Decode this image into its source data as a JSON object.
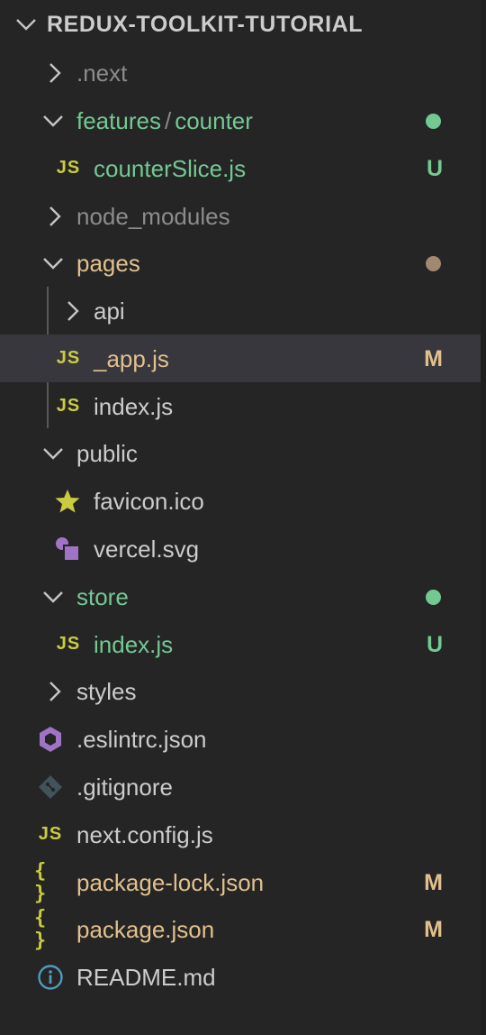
{
  "explorer": {
    "root_title": "REDUX-TOOLKIT-TUTORIAL",
    "colors": {
      "background": "#252526",
      "selected_row": "#37373d",
      "untracked": "#73c991",
      "modified": "#e2c08d",
      "ignored": "#8c8c8c",
      "default_text": "#cccccc",
      "js_icon": "#cbcb41",
      "modified_dot": "#a08871",
      "untracked_dot": "#73c991"
    },
    "items": [
      {
        "type": "folder",
        "label": ".next",
        "expanded": false,
        "icon": "chevron-right-icon"
      },
      {
        "type": "folder",
        "label": "features",
        "label_sep": "/",
        "label_b": "counter",
        "expanded": true,
        "icon": "chevron-down-icon",
        "status": "untracked-dot"
      },
      {
        "type": "file",
        "label": "counterSlice.js",
        "icon": "js-file-icon",
        "icon_text": "JS",
        "badge": "U"
      },
      {
        "type": "folder",
        "label": "node_modules",
        "expanded": false,
        "icon": "chevron-right-icon"
      },
      {
        "type": "folder",
        "label": "pages",
        "expanded": true,
        "icon": "chevron-down-icon",
        "status": "modified-dot"
      },
      {
        "type": "folder",
        "label": "api",
        "expanded": false,
        "icon": "chevron-right-icon"
      },
      {
        "type": "file",
        "label": "_app.js",
        "icon": "js-file-icon",
        "icon_text": "JS",
        "badge": "M",
        "selected": true
      },
      {
        "type": "file",
        "label": "index.js",
        "icon": "js-file-icon",
        "icon_text": "JS"
      },
      {
        "type": "folder",
        "label": "public",
        "expanded": true,
        "icon": "chevron-down-icon"
      },
      {
        "type": "file",
        "label": "favicon.ico",
        "icon": "star-icon"
      },
      {
        "type": "file",
        "label": "vercel.svg",
        "icon": "svg-shapes-icon"
      },
      {
        "type": "folder",
        "label": "store",
        "expanded": true,
        "icon": "chevron-down-icon",
        "status": "untracked-dot"
      },
      {
        "type": "file",
        "label": "index.js",
        "icon": "js-file-icon",
        "icon_text": "JS",
        "badge": "U"
      },
      {
        "type": "folder",
        "label": "styles",
        "expanded": false,
        "icon": "chevron-right-icon"
      },
      {
        "type": "file",
        "label": ".eslintrc.json",
        "icon": "eslint-hexagon-icon"
      },
      {
        "type": "file",
        "label": ".gitignore",
        "icon": "git-diamond-icon"
      },
      {
        "type": "file",
        "label": "next.config.js",
        "icon": "js-file-icon",
        "icon_text": "JS"
      },
      {
        "type": "file",
        "label": "package-lock.json",
        "icon": "json-braces-icon",
        "icon_text": "{ }",
        "badge": "M"
      },
      {
        "type": "file",
        "label": "package.json",
        "icon": "json-braces-icon",
        "icon_text": "{ }",
        "badge": "M"
      },
      {
        "type": "file",
        "label": "README.md",
        "icon": "info-circle-icon"
      }
    ]
  }
}
